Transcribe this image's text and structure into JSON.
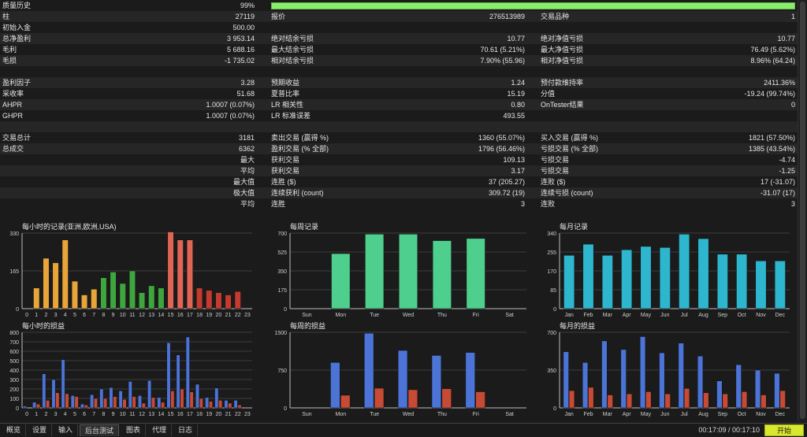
{
  "report": {
    "quality_bar_fill": 0.99,
    "rows": [
      [
        "质量历史",
        "99%",
        "",
        "",
        "",
        ""
      ],
      [
        "柱",
        "27119",
        "报价",
        "276513989",
        "交易品种",
        "1"
      ],
      [
        "初始入金",
        "500.00",
        "",
        "",
        "",
        ""
      ],
      [
        "总净盈利",
        "3 953.14",
        "绝对结余亏损",
        "10.77",
        "绝对净值亏损",
        "10.77"
      ],
      [
        "毛利",
        "5 688.16",
        "最大结余亏损",
        "70.61 (5.21%)",
        "最大净值亏损",
        "76.49 (5.62%)"
      ],
      [
        "毛损",
        "-1 735.02",
        "相对结余亏损",
        "7.90% (55.96)",
        "相对净值亏损",
        "8.96% (64.24)"
      ],
      [
        "",
        "",
        "",
        "",
        "",
        ""
      ],
      [
        "盈利因子",
        "3.28",
        "预期收益",
        "1.24",
        "预付款维持率",
        "2411.36%"
      ],
      [
        "采收率",
        "51.68",
        "夏普比率",
        "15.19",
        "分值",
        "-19.24 (99.74%)"
      ],
      [
        "AHPR",
        "1.0007 (0.07%)",
        "LR 相关性",
        "0.80",
        "OnTester结果",
        "0"
      ],
      [
        "GHPR",
        "1.0007 (0.07%)",
        "LR 标准误差",
        "493.55",
        "",
        ""
      ],
      [
        "",
        "",
        "",
        "",
        "",
        ""
      ],
      [
        "交易总计",
        "3181",
        "卖出交易 (赢得 %)",
        "1360 (55.07%)",
        "买入交易 (赢得 %)",
        "1821 (57.50%)"
      ],
      [
        "总成交",
        "6362",
        "盈利交易 (% 全部)",
        "1796 (56.46%)",
        "亏损交易 (% 全部)",
        "1385 (43.54%)"
      ],
      [
        "",
        "最大",
        "获利交易",
        "109.13",
        "亏损交易",
        "-4.74"
      ],
      [
        "",
        "平均",
        "获利交易",
        "3.17",
        "亏损交易",
        "-1.25"
      ],
      [
        "",
        "最大值",
        "连胜 ($)",
        "37 (205.27)",
        "连败 ($)",
        "17 (-31.07)"
      ],
      [
        "",
        "极大值",
        "连续获利 (count)",
        "309.72 (19)",
        "连续亏损 (count)",
        "-31.07 (17)"
      ],
      [
        "",
        "平均",
        "连胜",
        "3",
        "连败",
        "3"
      ]
    ]
  },
  "chart_data": [
    {
      "id": "hourly-entries",
      "type": "bar",
      "title": "每小时的记录(亚洲,欧洲,USA)",
      "categories": [
        "0",
        "1",
        "2",
        "3",
        "4",
        "5",
        "6",
        "7",
        "8",
        "9",
        "10",
        "11",
        "12",
        "13",
        "14",
        "15",
        "16",
        "17",
        "18",
        "19",
        "20",
        "21",
        "22",
        "23"
      ],
      "values": [
        0,
        90,
        220,
        200,
        300,
        120,
        60,
        85,
        135,
        160,
        110,
        165,
        70,
        100,
        90,
        335,
        300,
        300,
        90,
        80,
        70,
        60,
        75,
        0
      ],
      "colors": [
        "#e8a53a",
        "#e8a53a",
        "#e8a53a",
        "#e8a53a",
        "#e8a53a",
        "#e8a53a",
        "#e8a53a",
        "#e8a53a",
        "#3fa63f",
        "#3fa63f",
        "#3fa63f",
        "#3fa63f",
        "#3fa63f",
        "#3fa63f",
        "#3fa63f",
        "#e06555",
        "#e06555",
        "#e06555",
        "#c33b2e",
        "#c33b2e",
        "#c33b2e",
        "#c33b2e",
        "#c33b2e",
        "#c33b2e"
      ],
      "yticks": [
        0,
        165,
        330
      ],
      "ylim": [
        0,
        330
      ]
    },
    {
      "id": "weekly-entries",
      "type": "bar",
      "title": "每周记录",
      "categories": [
        "Sun",
        "Mon",
        "Tue",
        "Wed",
        "Thu",
        "Fri",
        "Sat"
      ],
      "values": [
        0,
        510,
        690,
        690,
        630,
        650,
        0
      ],
      "colors": [
        "#4fcf8d"
      ],
      "yticks": [
        0,
        175,
        350,
        525,
        700
      ],
      "ylim": [
        0,
        700
      ]
    },
    {
      "id": "monthly-entries",
      "type": "bar",
      "title": "每月记录",
      "categories": [
        "Jan",
        "Feb",
        "Mar",
        "Apr",
        "May",
        "Jun",
        "Jul",
        "Aug",
        "Sep",
        "Oct",
        "Nov",
        "Dec"
      ],
      "values": [
        240,
        290,
        240,
        265,
        280,
        275,
        335,
        315,
        245,
        245,
        215,
        215
      ],
      "colors": [
        "#2fb6cf"
      ],
      "yticks": [
        0,
        85,
        170,
        255,
        340
      ],
      "ylim": [
        0,
        340
      ]
    },
    {
      "id": "hourly-pnl",
      "type": "bar",
      "title": "每小时的损益",
      "categories": [
        "0",
        "1",
        "2",
        "3",
        "4",
        "5",
        "6",
        "7",
        "8",
        "9",
        "10",
        "11",
        "12",
        "13",
        "14",
        "15",
        "16",
        "17",
        "18",
        "19",
        "20",
        "21",
        "22",
        "23"
      ],
      "yticks": [
        0,
        100,
        200,
        300,
        400,
        500,
        600,
        700,
        800
      ],
      "ylim": [
        0,
        800
      ],
      "series": [
        {
          "values": [
            20,
            60,
            360,
            300,
            510,
            130,
            40,
            140,
            200,
            215,
            180,
            280,
            130,
            290,
            110,
            690,
            560,
            750,
            250,
            110,
            210,
            80,
            80,
            0
          ],
          "color": "#4b74d6"
        },
        {
          "values": [
            0,
            40,
            80,
            160,
            150,
            120,
            30,
            100,
            100,
            120,
            90,
            120,
            50,
            110,
            60,
            180,
            200,
            170,
            100,
            70,
            80,
            50,
            30,
            0
          ],
          "color": "#c74a34"
        }
      ]
    },
    {
      "id": "weekly-pnl",
      "type": "bar",
      "title": "每周的损益",
      "categories": [
        "Sun",
        "Mon",
        "Tue",
        "Wed",
        "Thu",
        "Fri",
        "Sat"
      ],
      "yticks": [
        0,
        750,
        1500
      ],
      "ylim": [
        0,
        1500
      ],
      "series": [
        {
          "values": [
            0,
            900,
            1480,
            1140,
            1040,
            1100,
            0
          ],
          "color": "#4b74d6"
        },
        {
          "values": [
            0,
            250,
            390,
            360,
            380,
            320,
            0
          ],
          "color": "#c74a34"
        }
      ]
    },
    {
      "id": "monthly-pnl",
      "type": "bar",
      "title": "每月的损益",
      "categories": [
        "Jan",
        "Feb",
        "Mar",
        "Apr",
        "May",
        "Jun",
        "Jul",
        "Aug",
        "Sep",
        "Oct",
        "Nov",
        "Dec"
      ],
      "yticks": [
        0,
        350,
        700
      ],
      "ylim": [
        0,
        700
      ],
      "series": [
        {
          "values": [
            520,
            420,
            620,
            540,
            660,
            510,
            600,
            480,
            250,
            400,
            350,
            320
          ],
          "color": "#4b74d6"
        },
        {
          "values": [
            160,
            190,
            120,
            130,
            150,
            130,
            180,
            140,
            130,
            150,
            120,
            160
          ],
          "color": "#c74a34"
        }
      ]
    }
  ],
  "status": {
    "tabs": [
      "概览",
      "设置",
      "输入",
      "后台测试",
      "图表",
      "代理",
      "日志"
    ],
    "active_tab": 3,
    "timer": "00:17:09 / 00:17:10",
    "start_label": "开始",
    "start_color": "#d8e82c"
  }
}
